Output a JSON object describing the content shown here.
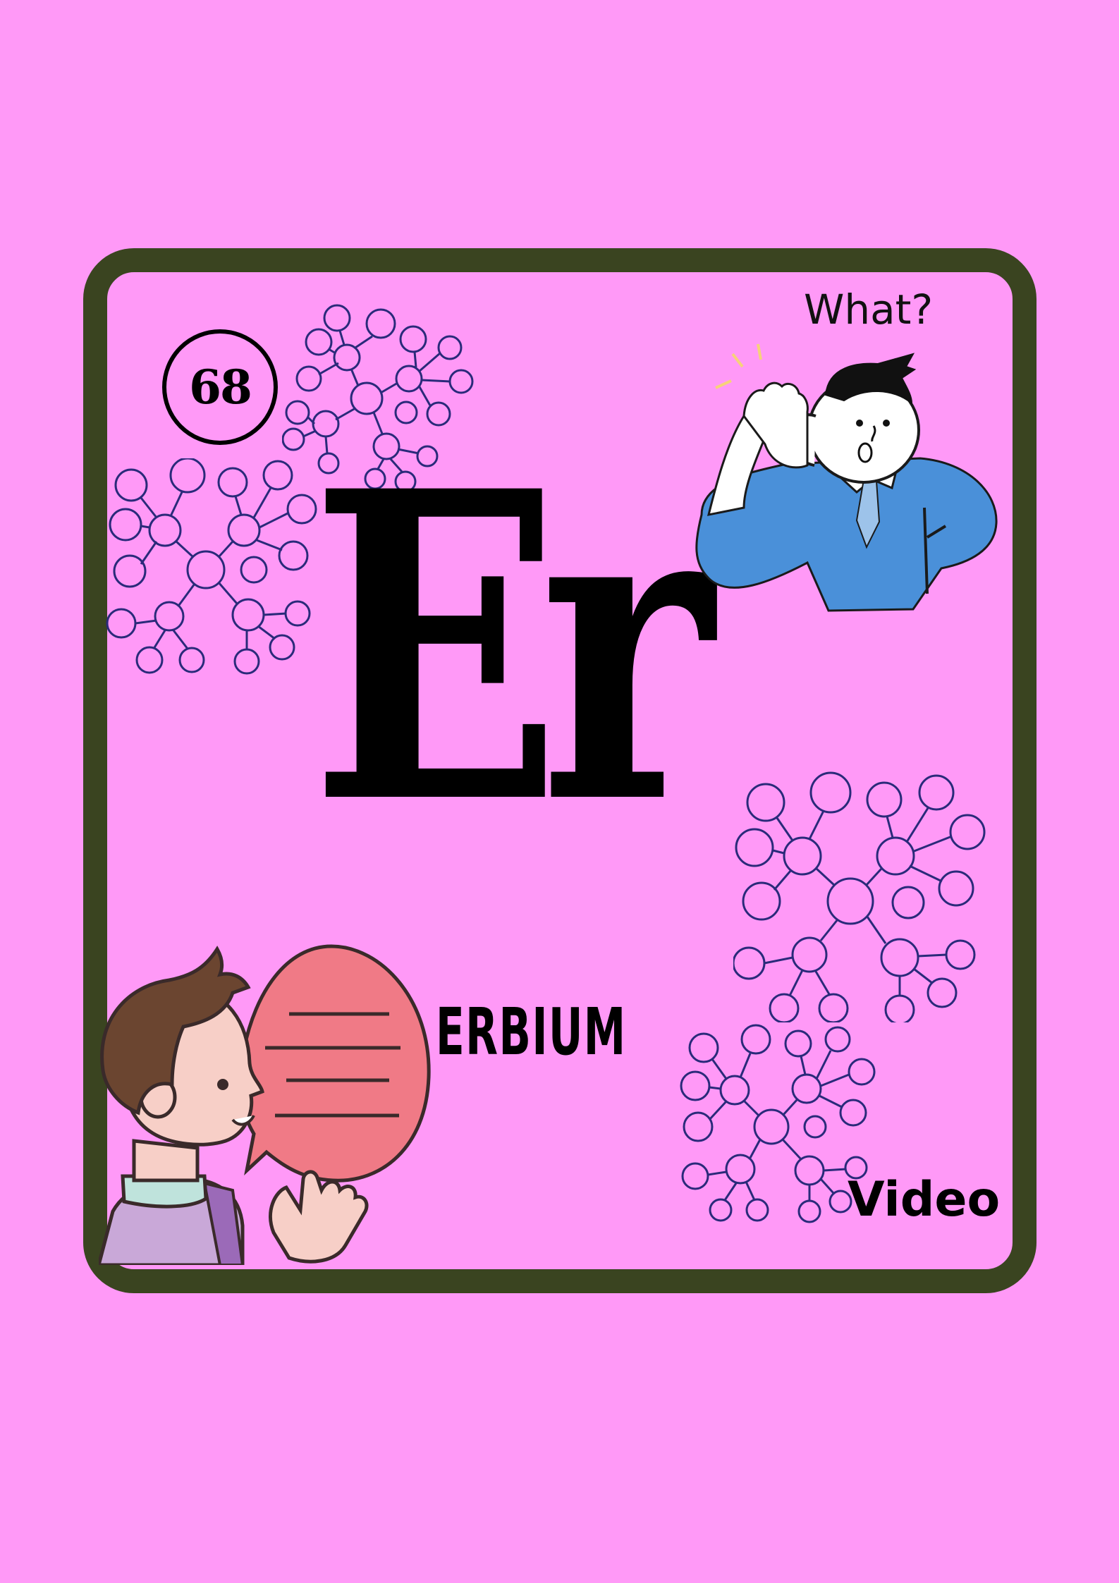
{
  "element": {
    "atomic_number": "68",
    "symbol": "Er",
    "name": "ERBIUM"
  },
  "labels": {
    "question": "What?",
    "video": "Video"
  },
  "colors": {
    "background": "#ff99f7",
    "frame": "#3a4420",
    "network": "#2a2a7a",
    "shirt_blue": "#4a90d9",
    "speech_bubble": "#f07a86"
  },
  "icons": {
    "listening_person": "listening-person-icon",
    "talking_person": "talking-person-icon",
    "networks": "molecule-network-icon"
  }
}
